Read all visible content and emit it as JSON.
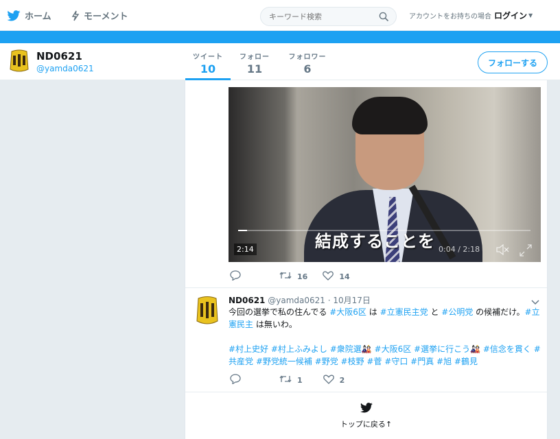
{
  "nav": {
    "home_label": "ホーム",
    "moments_label": "モーメント",
    "search_placeholder": "キーワード検索",
    "account_prompt": "アカウントをお持ちの場合",
    "login_label": "ログイン"
  },
  "profile": {
    "name": "ND0621",
    "handle": "@yamda0621",
    "stats": [
      {
        "label": "ツイート",
        "value": "10"
      },
      {
        "label": "フォロー",
        "value": "11"
      },
      {
        "label": "フォロワー",
        "value": "6"
      }
    ],
    "follow_button": "フォローする"
  },
  "video": {
    "subtitle": "結成することを",
    "duration": "2:14",
    "time_readout": "0:04 / 2:18",
    "progress": 0.03
  },
  "tweet1_actions": {
    "retweets": "16",
    "likes": "14"
  },
  "tweet2": {
    "name": "ND0621",
    "handle": "@yamda0621",
    "date": "· 10月17日",
    "text_parts": [
      {
        "t": "今回の選挙で私の住んでる ",
        "ht": false
      },
      {
        "t": "#大阪6区",
        "ht": true
      },
      {
        "t": " は ",
        "ht": false
      },
      {
        "t": "#立憲民主党",
        "ht": true
      },
      {
        "t": " と ",
        "ht": false
      },
      {
        "t": "#公明党",
        "ht": true
      },
      {
        "t": " の候補だけ。",
        "ht": false
      },
      {
        "t": "#立憲民主",
        "ht": true
      },
      {
        "t": " は無いわ。",
        "ht": false
      }
    ],
    "tags_line": "#村上史好 #村上ふみよし #衆院選🎎 #大阪6区 #選挙に行こう🎎 #信念を貫く #共産党 #野党統一候補 #野党  #枝野  #菅 #守口 #門真 #旭 #鶴見",
    "retweets": "1",
    "likes": "2"
  },
  "back_to_top": "トップに戻る↑",
  "colors": {
    "accent": "#1da1f2",
    "text": "#14171a",
    "muted": "#657786"
  }
}
